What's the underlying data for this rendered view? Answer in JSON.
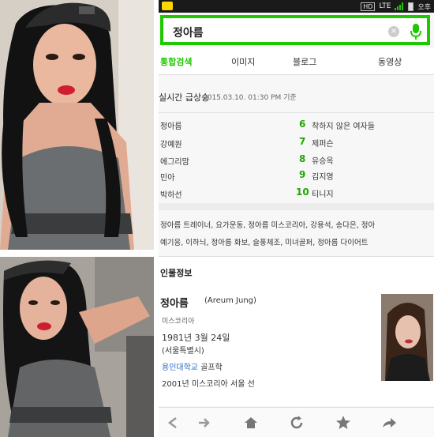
{
  "status_bar": {
    "lte": "LTE",
    "hd": "HD",
    "time": "오후"
  },
  "search": {
    "query": "정아름",
    "clear_icon": "×"
  },
  "tabs": [
    "통합검색",
    "이미지",
    "블로그",
    "동영상"
  ],
  "ranking": {
    "title": "실시간 급상승",
    "timestamp": "2015.03.10. 01:30 PM 기준",
    "left": [
      "정아름",
      "강예원",
      "에그리맘",
      "민아",
      "박하선"
    ],
    "right": [
      {
        "num": "6",
        "label": "착하지 않은 여자들"
      },
      {
        "num": "7",
        "label": "제퍼슨"
      },
      {
        "num": "8",
        "label": "유승옥"
      },
      {
        "num": "9",
        "label": "김지영"
      },
      {
        "num": "10",
        "label": "티니지"
      }
    ]
  },
  "related": {
    "line1": "정아름 트레이너, 요가운동, 정아름 미스코리아, 강용석, 송다은, 정아",
    "line2": "예기응, 이하늬, 정아름 화보, 슬풍체조, 미녀골퍼, 정아름 다이어트"
  },
  "profile": {
    "header": "인물정보",
    "name": "정아름",
    "english_name": "(Areum Jung)",
    "occupation": "미스코리아",
    "birth": "1981년 3월 24일",
    "birthplace": "(서울특별시)",
    "school_link": "용인대학교",
    "school_major": "골프학",
    "award": "2001년 미스코리아 서울 선"
  },
  "icons": {
    "mic": "microphone-icon",
    "back": "back-arrow-icon",
    "forward": "forward-arrow-icon",
    "home": "home-icon",
    "refresh": "refresh-icon",
    "bookmark": "star-icon",
    "share": "share-icon"
  },
  "colors": {
    "accent": "#1ec800",
    "rank_number": "#1ea800",
    "link": "#2b6dc9",
    "status_bar": "#1a1a1a"
  }
}
